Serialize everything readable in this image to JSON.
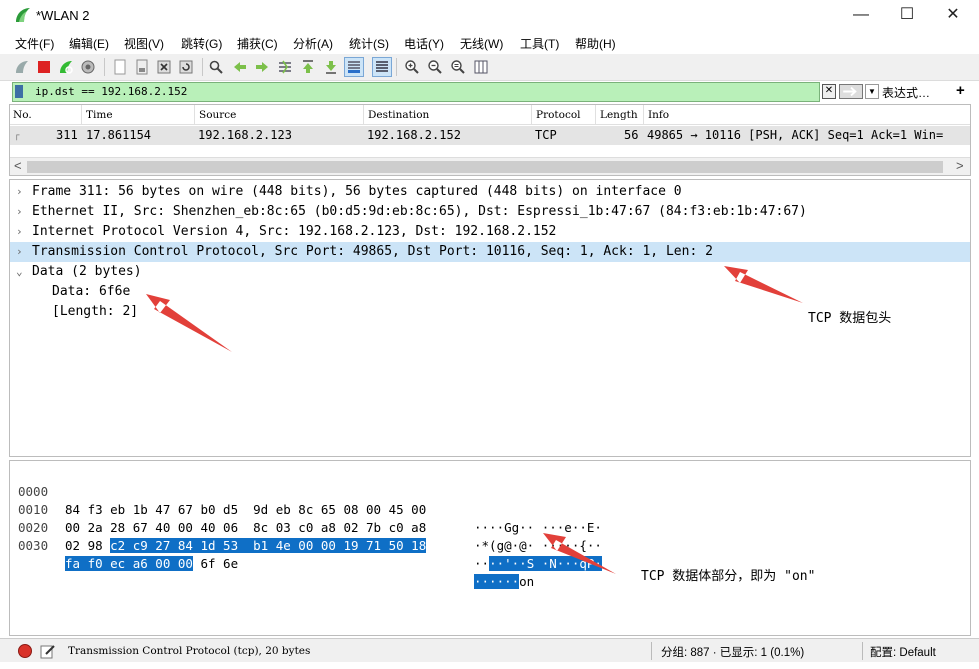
{
  "window": {
    "title": "*WLAN 2",
    "minimize_glyph": "—",
    "maximize_glyph": "☐",
    "close_glyph": "✕"
  },
  "menu": [
    "文件(F)",
    "编辑(E)",
    "视图(V)",
    "跳转(G)",
    "捕获(C)",
    "分析(A)",
    "统计(S)",
    "电话(Y)",
    "无线(W)",
    "工具(T)",
    "帮助(H)"
  ],
  "toolbar": {
    "icons": [
      "shark-fin-icon",
      "stop-icon",
      "restart-icon",
      "options-gear-icon",
      "open-file-icon",
      "save-file-icon",
      "close-file-icon",
      "reload-icon",
      "find-icon",
      "back-arrow-icon",
      "forward-arrow-icon",
      "goto-packet-icon",
      "first-packet-icon",
      "last-packet-icon",
      "autoscroll-icon",
      "colorize-icon",
      "zoom-in-icon",
      "zoom-out-icon",
      "zoom-reset-icon",
      "resize-columns-icon"
    ]
  },
  "filter": {
    "value": "ip.dst == 192.168.2.152",
    "clear_glyph": "✕",
    "history_glyph": "▼",
    "expression_label": "表达式…",
    "plus_label": "+"
  },
  "packet_list": {
    "columns": [
      "No.",
      "Time",
      "Source",
      "Destination",
      "Protocol",
      "Length",
      "Info"
    ],
    "row": {
      "no": "311",
      "time": "17.861154",
      "source": "192.168.2.123",
      "destination": "192.168.2.152",
      "protocol": "TCP",
      "length": "56",
      "info": "49865 → 10116 [PSH, ACK] Seq=1 Ack=1 Win="
    },
    "scroll_left": "<",
    "scroll_right": ">"
  },
  "details": {
    "rows": [
      {
        "chev": "›",
        "text": "Frame 311: 56 bytes on wire (448 bits), 56 bytes captured (448 bits) on interface 0"
      },
      {
        "chev": "›",
        "text": "Ethernet II, Src: Shenzhen_eb:8c:65 (b0:d5:9d:eb:8c:65), Dst: Espressi_1b:47:67 (84:f3:eb:1b:47:67)"
      },
      {
        "chev": "›",
        "text": "Internet Protocol Version 4, Src: 192.168.2.123, Dst: 192.168.2.152"
      },
      {
        "chev": "›",
        "text": "Transmission Control Protocol, Src Port: 49865, Dst Port: 10116, Seq: 1, Ack: 1, Len: 2"
      },
      {
        "chev": "⌄",
        "text": "Data (2 bytes)"
      },
      {
        "chev": "",
        "text": "Data: 6f6e"
      },
      {
        "chev": "",
        "text": "[Length: 2]"
      }
    ]
  },
  "bytes": {
    "rows": [
      {
        "offset": "0000",
        "hex_plain": "84 f3 eb 1b 47 67 b0 d5  9d eb 8c 65 08 00 45 00",
        "hex_hl": "",
        "hex_tail": "",
        "asc_plain": "····Gg·· ···e··E·",
        "asc_hl": "",
        "asc_tail": ""
      },
      {
        "offset": "0010",
        "hex_plain": "00 2a 28 67 40 00 40 06  8c 03 c0 a8 02 7b c0 a8",
        "hex_hl": "",
        "hex_tail": "",
        "asc_plain": "·*(g@·@· ·····{··",
        "asc_hl": "",
        "asc_tail": ""
      },
      {
        "offset": "0020",
        "hex_plain": "02 98 ",
        "hex_hl": "c2 c9 27 84 1d 53  b1 4e 00 00 19 71 50 18",
        "hex_tail": "",
        "asc_plain": "··",
        "asc_hl": "··'··S ·N···qP·",
        "asc_tail": ""
      },
      {
        "offset": "0030",
        "hex_plain": "",
        "hex_hl": "fa f0 ec a6 00 00",
        "hex_tail": " 6f 6e",
        "asc_plain": "",
        "asc_hl": "······",
        "asc_tail": "on"
      }
    ]
  },
  "status": {
    "text": "Transmission Control Protocol (tcp), 20 bytes",
    "packets": "分组: 887 · 已显示: 1 (0.1%)",
    "profile": "配置: Default"
  },
  "annotations": {
    "header_note": "TCP 数据包头",
    "body_note": "TCP 数据体部分，即为 \"on\""
  },
  "colors": {
    "filter_ok": "#b9f0b9",
    "selection": "#cce4f7",
    "byte_highlight": "#0f6fc6",
    "arrow": "#e2403a"
  }
}
